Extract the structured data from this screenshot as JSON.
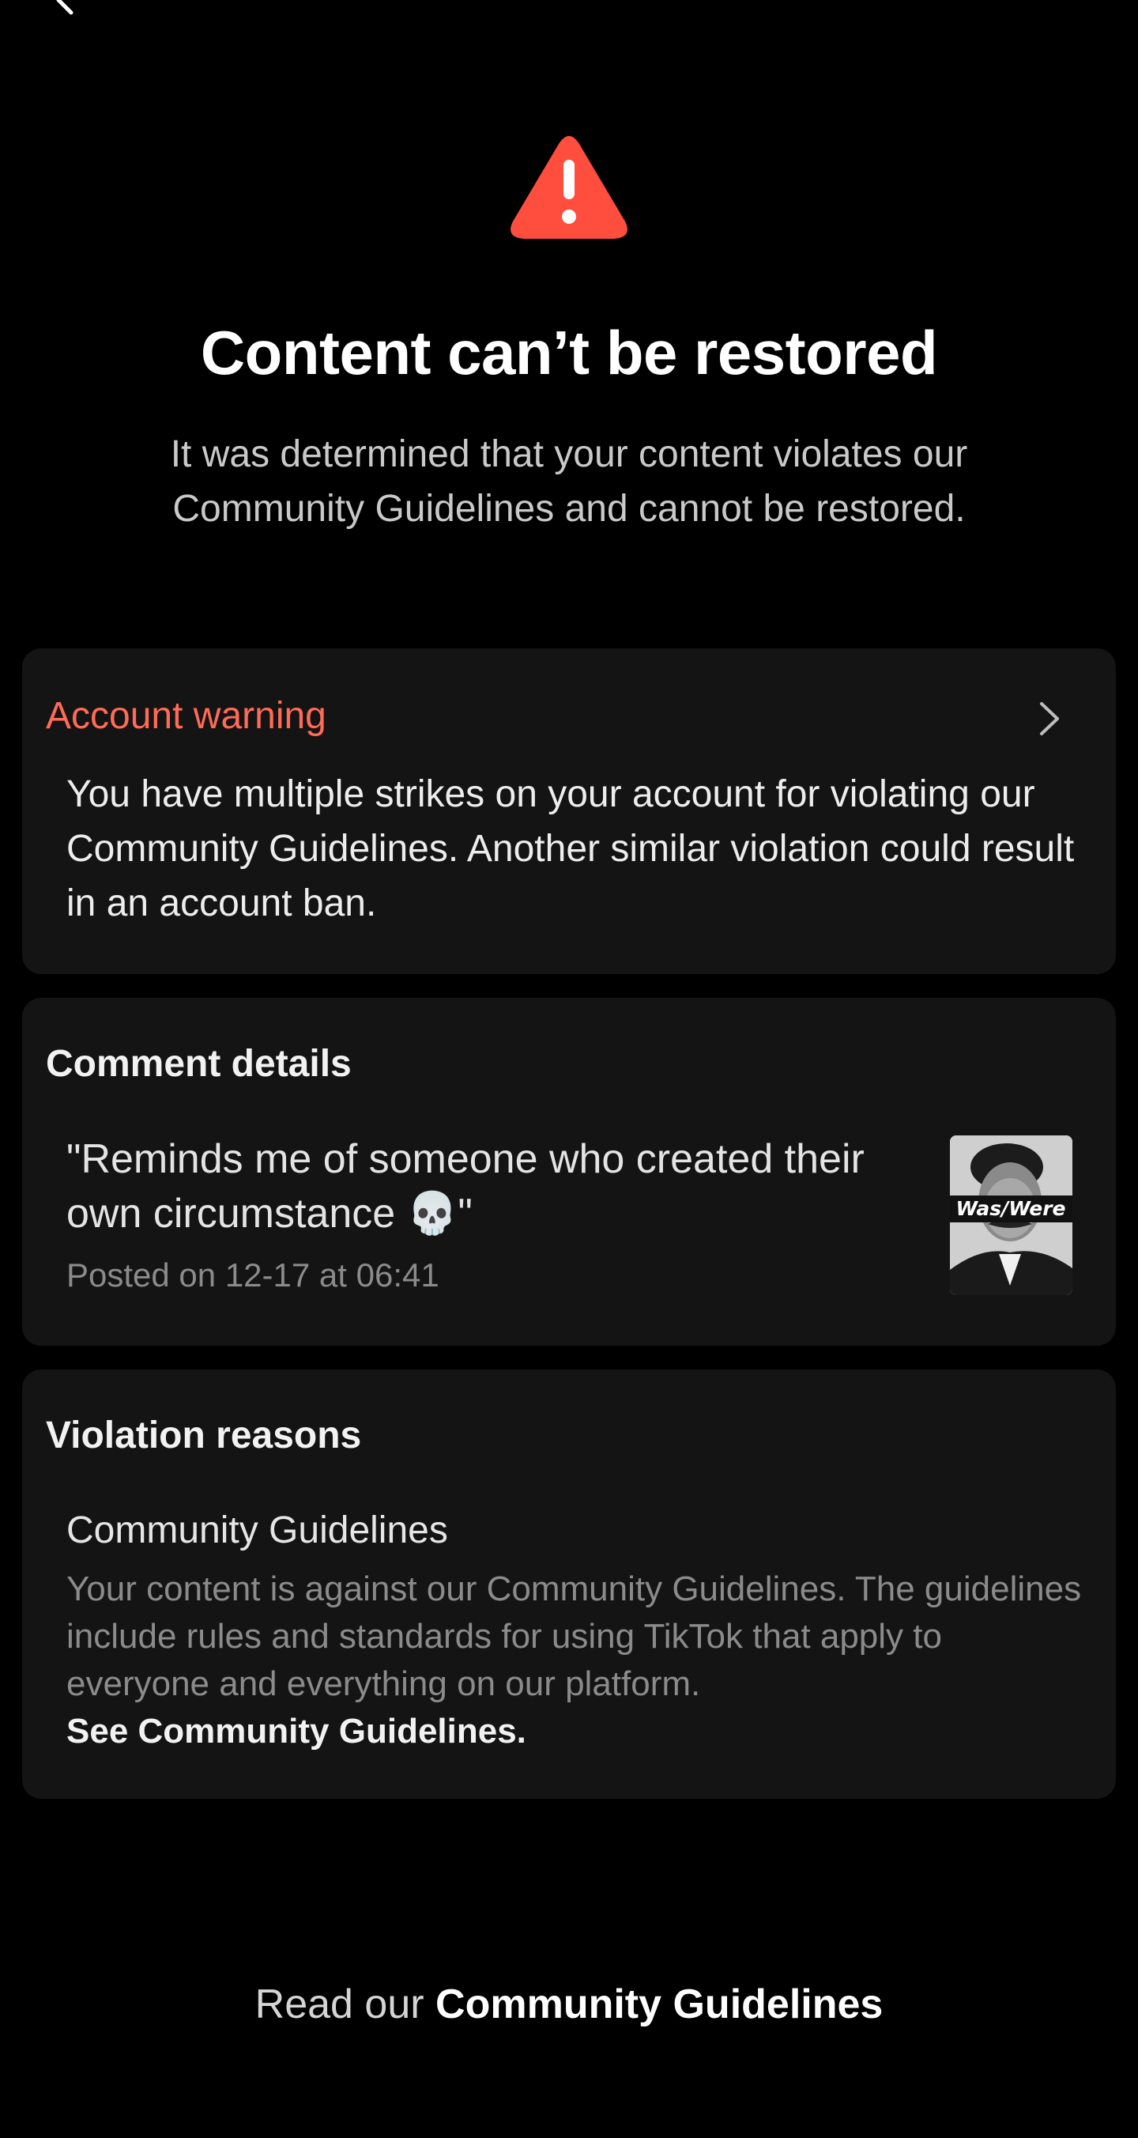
{
  "header": {
    "back_icon": "chevron-left-icon"
  },
  "status": {
    "icon": "warning-triangle-icon",
    "icon_color": "#ff4d3e",
    "title": "Content can’t be restored",
    "subtitle": "It was determined that your content violates our Community Guidelines and cannot be restored."
  },
  "account_warning": {
    "heading": "Account warning",
    "heading_color": "#ff6b57",
    "body": "You have multiple strikes on your account for violating our Community Guidelines. Another similar violation could result in an account ban.",
    "chevron_icon": "chevron-right-icon"
  },
  "comment_details": {
    "heading": "Comment details",
    "comment": "\"Reminds me of someone who created their own circumstance 💀\"",
    "posted": "Posted on 12-17 at 06:41",
    "thumbnail_caption": "Was/Were"
  },
  "violation_reasons": {
    "heading": "Violation reasons",
    "reason_title": "Community Guidelines",
    "reason_body": "Your content is against our Community Guidelines. The guidelines include rules and standards for using TikTok that apply to everyone and everything on our platform.",
    "link_label": "See Community Guidelines."
  },
  "footer": {
    "prefix": "Read our",
    "link_label": "Community Guidelines"
  }
}
